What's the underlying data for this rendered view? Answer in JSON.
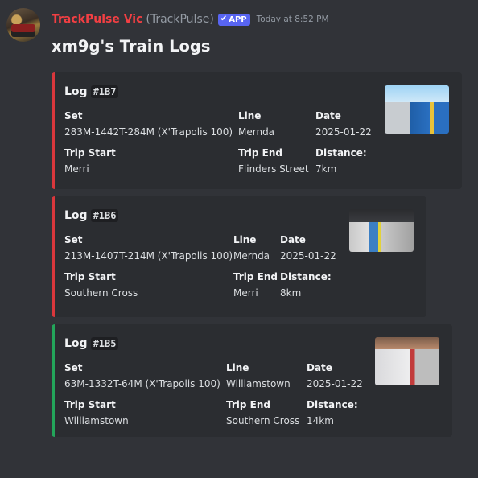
{
  "message": {
    "bot_name": "TrackPulse Vic",
    "bot_handle": "(TrackPulse)",
    "app_badge": "APP",
    "timestamp": "Today at 8:52 PM",
    "title": "xm9g's Train Logs"
  },
  "labels": {
    "log": "Log",
    "set": "Set",
    "line": "Line",
    "date": "Date",
    "trip_start": "Trip Start",
    "trip_end": "Trip End",
    "distance": "Distance:"
  },
  "logs": [
    {
      "id": "#1B7",
      "set": "283M-1442T-284M (X'Trapolis 100)",
      "line": "Mernda",
      "date": "2025-01-22",
      "trip_start": "Merri",
      "trip_end": "Flinders Street",
      "distance": "7km",
      "accent": "#da373c"
    },
    {
      "id": "#1B6",
      "set": "213M-1407T-214M (X'Trapolis 100)",
      "line": "Mernda",
      "date": "2025-01-22",
      "trip_start": "Southern Cross",
      "trip_end": "Merri",
      "distance": "8km",
      "accent": "#da373c"
    },
    {
      "id": "#1B5",
      "set": "63M-1332T-64M (X'Trapolis 100)",
      "line": "Williamstown",
      "date": "2025-01-22",
      "trip_start": "Williamstown",
      "trip_end": "Southern Cross",
      "distance": "14km",
      "accent": "#23a55a"
    }
  ]
}
